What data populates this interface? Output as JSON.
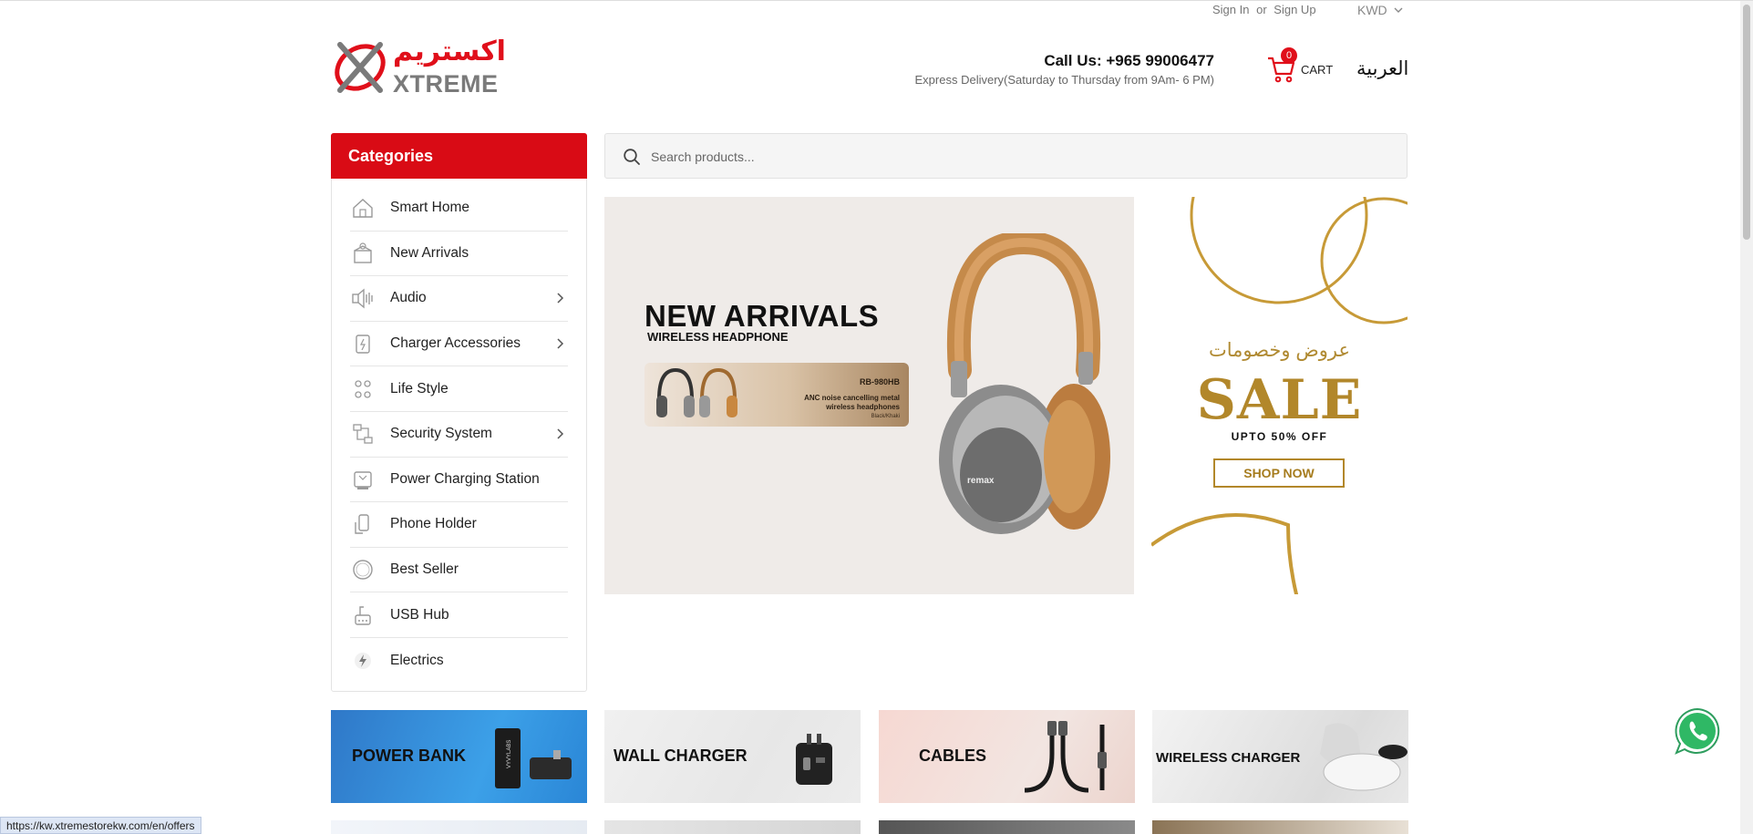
{
  "topbar": {
    "sign_in": "Sign In",
    "or": "or",
    "sign_up": "Sign Up",
    "currency": "KWD"
  },
  "header": {
    "logo_arabic": "اكستريم",
    "logo_text": "XTREME",
    "call": "Call Us: +965 99006477",
    "express": "Express Delivery(Saturday to Thursday from 9Am- 6 PM)",
    "cart_count": "0",
    "cart_label": "CART",
    "language": "العربية"
  },
  "categories": {
    "title": "Categories",
    "items": [
      {
        "label": "Smart Home",
        "icon": "smart-home-icon",
        "has_sub": false
      },
      {
        "label": "New Arrivals",
        "icon": "new-arrivals-icon",
        "has_sub": false
      },
      {
        "label": "Audio",
        "icon": "audio-icon",
        "has_sub": true
      },
      {
        "label": "Charger Accessories",
        "icon": "charger-icon",
        "has_sub": true
      },
      {
        "label": "Life Style",
        "icon": "lifestyle-icon",
        "has_sub": false
      },
      {
        "label": "Security System",
        "icon": "security-icon",
        "has_sub": true
      },
      {
        "label": "Power Charging Station",
        "icon": "charging-station-icon",
        "has_sub": false
      },
      {
        "label": "Phone Holder",
        "icon": "phone-holder-icon",
        "has_sub": false
      },
      {
        "label": "Best Seller",
        "icon": "best-seller-icon",
        "has_sub": false
      },
      {
        "label": "USB Hub",
        "icon": "usb-hub-icon",
        "has_sub": false
      },
      {
        "label": "Electrics",
        "icon": "electrics-icon",
        "has_sub": false
      }
    ]
  },
  "search": {
    "placeholder": "Search products..."
  },
  "hero": {
    "title": "NEW ARRIVALS",
    "subtitle": "WIRELESS HEADPHONE",
    "model": "RB-980HB",
    "description": "ANC noise cancelling metal wireless headphones",
    "color": "Black/Khaki",
    "brand": "remax"
  },
  "sale": {
    "arabic": "عروض وخصومات",
    "title": "SALE",
    "upto": "UPTO 50% OFF",
    "button": "SHOP NOW"
  },
  "tiles": [
    {
      "label": "POWER BANK",
      "product": "VYVYLABS"
    },
    {
      "label": "WALL CHARGER"
    },
    {
      "label": "CABLES"
    },
    {
      "label": "WIRELESS CHARGER"
    }
  ],
  "status_url": "https://kw.xtremestorekw.com/en/offers",
  "colors": {
    "brand_red": "#d90b15",
    "gold": "#b2872a"
  }
}
